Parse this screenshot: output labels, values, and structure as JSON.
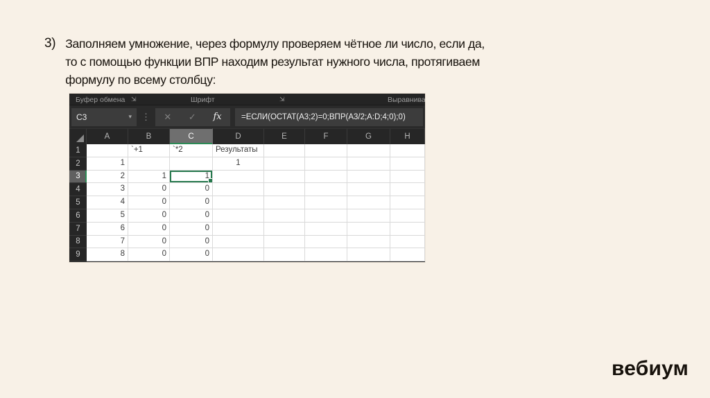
{
  "slide": {
    "item_number": "3)",
    "instruction_lines": [
      "Заполняем умножение, через формулу проверяем чётное ли число, если да,",
      "то с помощью функции ВПР находим результат нужного числа, протягиваем",
      "формулу по всему столбцу:"
    ],
    "logo_text": "вебиум"
  },
  "excel": {
    "ribbon_groups": {
      "clipboard": "Буфер обмена",
      "font": "Шрифт",
      "alignment": "Выравнивани"
    },
    "name_box_value": "C3",
    "formula": "=ЕСЛИ(ОСТАТ(A3;2)=0;ВПР(A3/2;A:D;4;0);0)",
    "fx_label": "fx",
    "cancel_glyph": "✕",
    "enter_glyph": "✓",
    "caret_glyph": "▾",
    "dots_glyph": "⋮",
    "launcher_glyph": "⇲",
    "columns": [
      "A",
      "B",
      "C",
      "D",
      "E",
      "F",
      "G",
      "H"
    ],
    "selected_cell": "C3",
    "grid": {
      "r1": {
        "num": "1",
        "A": "",
        "B": "`+1",
        "C": "`*2",
        "D": "Результаты",
        "E": "",
        "F": "",
        "G": "",
        "H": ""
      },
      "r2": {
        "num": "2",
        "A": "1",
        "B": "",
        "C": "",
        "D": "1",
        "E": "",
        "F": "",
        "G": "",
        "H": ""
      },
      "r3": {
        "num": "3",
        "A": "2",
        "B": "1",
        "C": "1",
        "D": "",
        "E": "",
        "F": "",
        "G": "",
        "H": ""
      },
      "r4": {
        "num": "4",
        "A": "3",
        "B": "0",
        "C": "0",
        "D": "",
        "E": "",
        "F": "",
        "G": "",
        "H": ""
      },
      "r5": {
        "num": "5",
        "A": "4",
        "B": "0",
        "C": "0",
        "D": "",
        "E": "",
        "F": "",
        "G": "",
        "H": ""
      },
      "r6": {
        "num": "6",
        "A": "5",
        "B": "0",
        "C": "0",
        "D": "",
        "E": "",
        "F": "",
        "G": "",
        "H": ""
      },
      "r7": {
        "num": "7",
        "A": "6",
        "B": "0",
        "C": "0",
        "D": "",
        "E": "",
        "F": "",
        "G": "",
        "H": ""
      },
      "r8": {
        "num": "8",
        "A": "7",
        "B": "0",
        "C": "0",
        "D": "",
        "E": "",
        "F": "",
        "G": "",
        "H": ""
      },
      "r9": {
        "num": "9",
        "A": "8",
        "B": "0",
        "C": "0",
        "D": "",
        "E": "",
        "F": "",
        "G": "",
        "H": ""
      }
    }
  },
  "colors": {
    "slide_background": "#f8f1e7",
    "excel_chrome": "#262626",
    "excel_panel": "#3c3c3c",
    "selection_green": "#27794e",
    "header_selected_gray": "#6f6f6f",
    "gridline": "#d9d9d9"
  }
}
